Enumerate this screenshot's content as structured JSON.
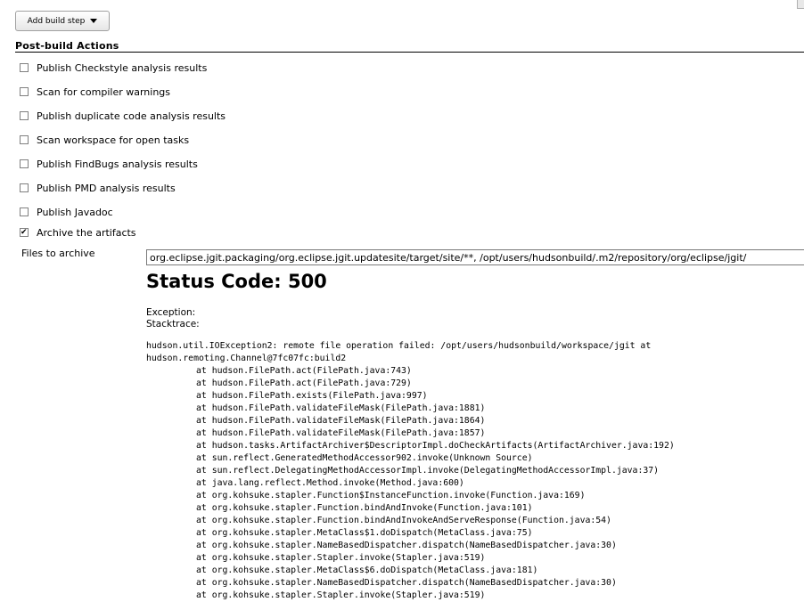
{
  "toolbar": {
    "add_build_step": "Add build step"
  },
  "post_build": {
    "title": "Post-build Actions",
    "options": [
      {
        "label": "Publish Checkstyle analysis results",
        "checked": false
      },
      {
        "label": "Scan for compiler warnings",
        "checked": false
      },
      {
        "label": "Publish duplicate code analysis results",
        "checked": false
      },
      {
        "label": "Scan workspace for open tasks",
        "checked": false
      },
      {
        "label": "Publish FindBugs analysis results",
        "checked": false
      },
      {
        "label": "Publish PMD analysis results",
        "checked": false
      },
      {
        "label": "Publish Javadoc",
        "checked": false
      },
      {
        "label": "Archive the artifacts",
        "checked": true
      }
    ],
    "files_label": "Files to archive",
    "files_value": "org.eclipse.jgit.packaging/org.eclipse.jgit.updatesite/target/site/**, /opt/users/hudsonbuild/.m2/repository/org/eclipse/jgit/"
  },
  "error": {
    "status": "Status Code: 500",
    "exception_label": "Exception:",
    "stacktrace_label": "Stacktrace:",
    "trace_head": [
      "hudson.util.IOException2: remote file operation failed: /opt/users/hudsonbuild/workspace/jgit at",
      "hudson.remoting.Channel@7fc07fc:build2"
    ],
    "frames": [
      "at hudson.FilePath.act(FilePath.java:743)",
      "at hudson.FilePath.act(FilePath.java:729)",
      "at hudson.FilePath.exists(FilePath.java:997)",
      "at hudson.FilePath.validateFileMask(FilePath.java:1881)",
      "at hudson.FilePath.validateFileMask(FilePath.java:1864)",
      "at hudson.FilePath.validateFileMask(FilePath.java:1857)",
      "at hudson.tasks.ArtifactArchiver$DescriptorImpl.doCheckArtifacts(ArtifactArchiver.java:192)",
      "at sun.reflect.GeneratedMethodAccessor902.invoke(Unknown Source)",
      "at sun.reflect.DelegatingMethodAccessorImpl.invoke(DelegatingMethodAccessorImpl.java:37)",
      "at java.lang.reflect.Method.invoke(Method.java:600)",
      "at org.kohsuke.stapler.Function$InstanceFunction.invoke(Function.java:169)",
      "at org.kohsuke.stapler.Function.bindAndInvoke(Function.java:101)",
      "at org.kohsuke.stapler.Function.bindAndInvokeAndServeResponse(Function.java:54)",
      "at org.kohsuke.stapler.MetaClass$1.doDispatch(MetaClass.java:75)",
      "at org.kohsuke.stapler.NameBasedDispatcher.dispatch(NameBasedDispatcher.java:30)",
      "at org.kohsuke.stapler.Stapler.invoke(Stapler.java:519)",
      "at org.kohsuke.stapler.MetaClass$6.doDispatch(MetaClass.java:181)",
      "at org.kohsuke.stapler.NameBasedDispatcher.dispatch(NameBasedDispatcher.java:30)",
      "at org.kohsuke.stapler.Stapler.invoke(Stapler.java:519)"
    ]
  }
}
